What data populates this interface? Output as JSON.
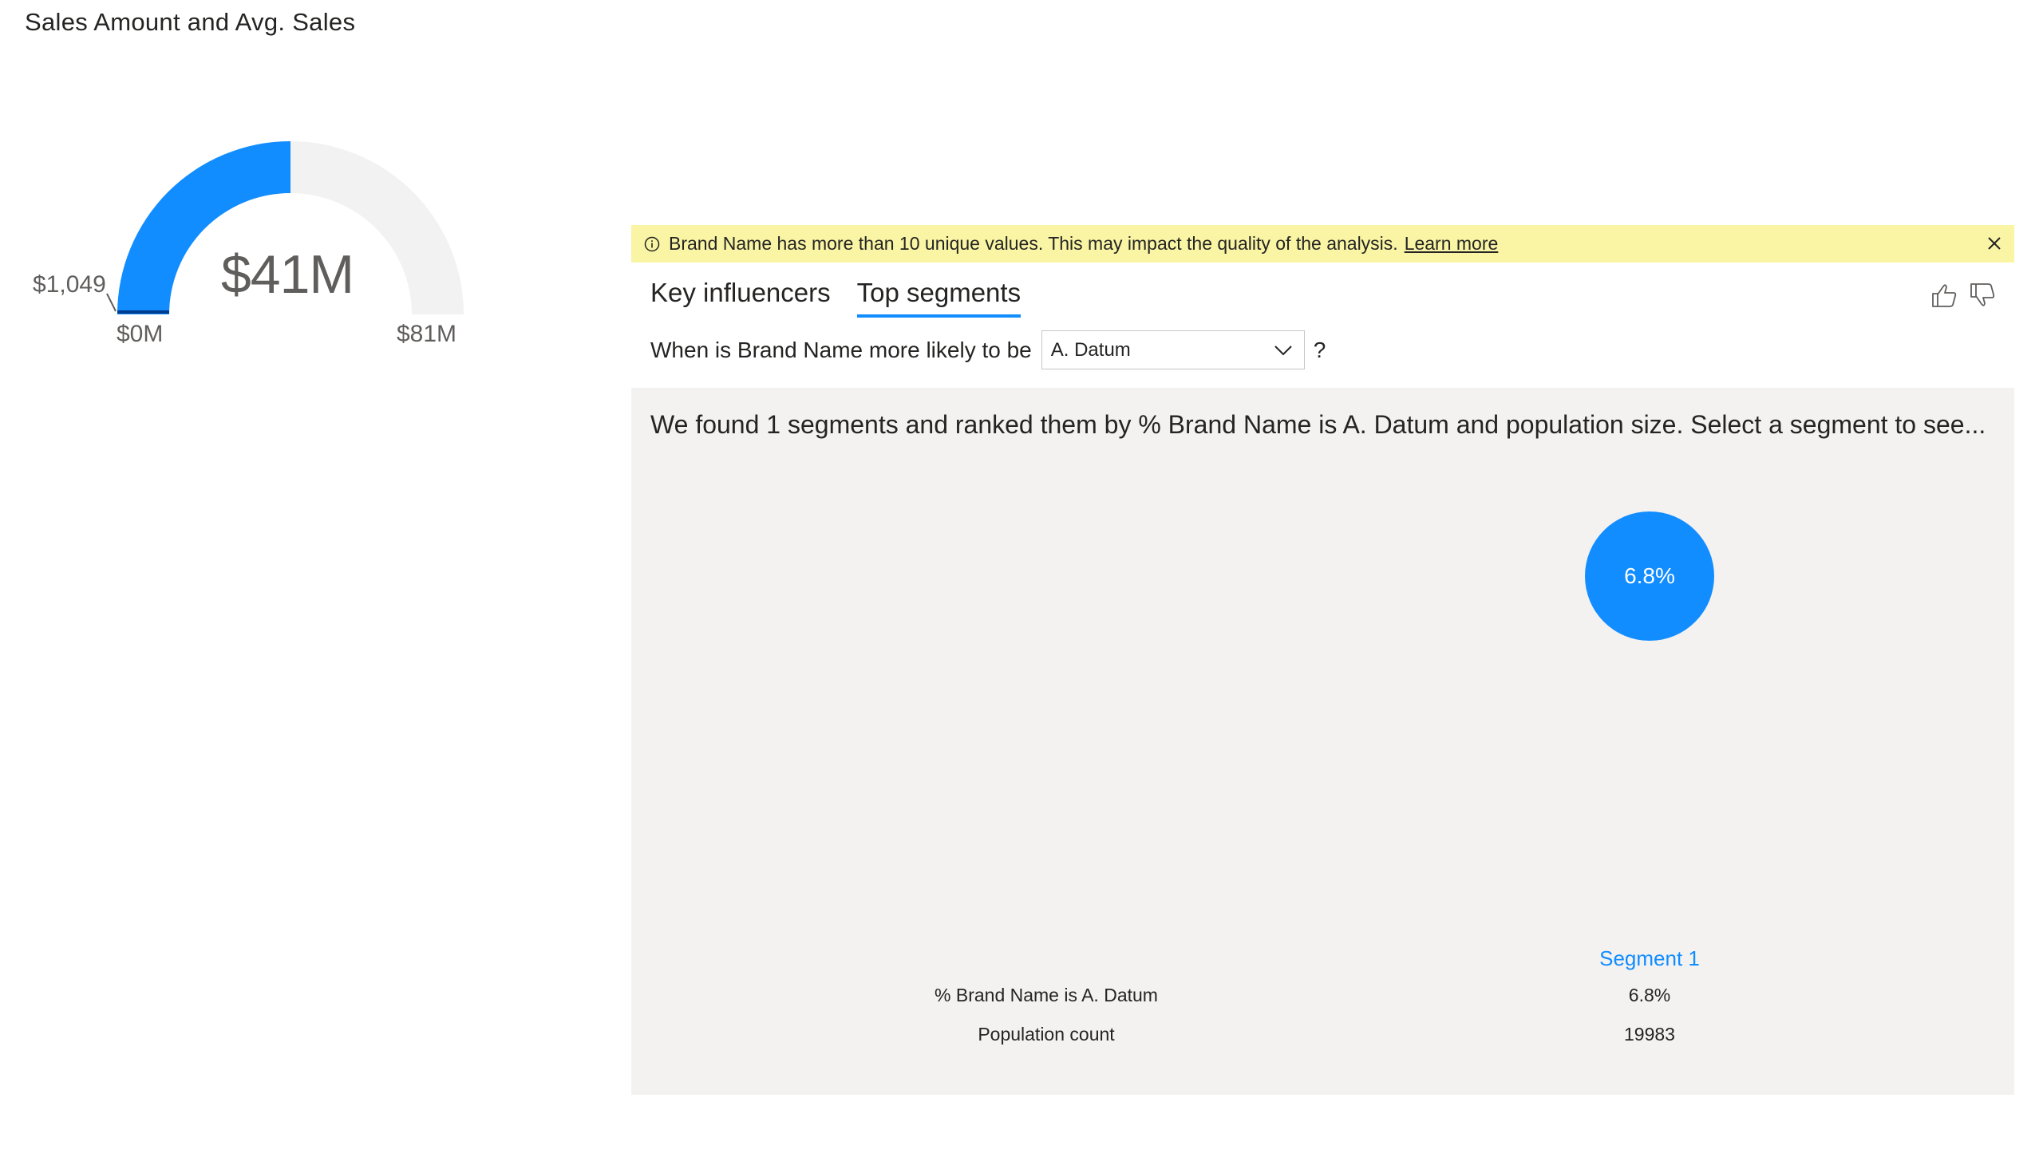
{
  "gauge": {
    "title": "Sales Amount and Avg. Sales",
    "value_label": "$41M",
    "min_label": "$0M",
    "max_label": "$81M",
    "target_label": "$1,049",
    "fill_fraction": 0.5,
    "colors": {
      "fill": "#118dff",
      "track": "#f2f2f2",
      "target": "#003c8f"
    }
  },
  "key_influencers": {
    "warning": {
      "text": "Brand Name has more than 10 unique values. This may impact the quality of the analysis.",
      "link": "Learn more"
    },
    "tabs": [
      {
        "label": "Key influencers",
        "active": false
      },
      {
        "label": "Top segments",
        "active": true
      }
    ],
    "question": {
      "prefix": "When is Brand Name more likely to be",
      "selected": "A. Datum",
      "suffix": "?"
    },
    "summary": "We found 1 segments and ranked them by % Brand Name is A. Datum and population size. Select a segment to see...",
    "segments": [
      {
        "name": "Segment 1",
        "bubble_label": "6.8%",
        "percent": "6.8%",
        "population": "19983"
      }
    ],
    "row_labels": {
      "percent": "% Brand Name is A. Datum",
      "population": "Population count"
    },
    "colors": {
      "accent": "#118dff",
      "warning_bg": "#f9f5a4",
      "panel_bg": "#f3f2f1"
    }
  }
}
